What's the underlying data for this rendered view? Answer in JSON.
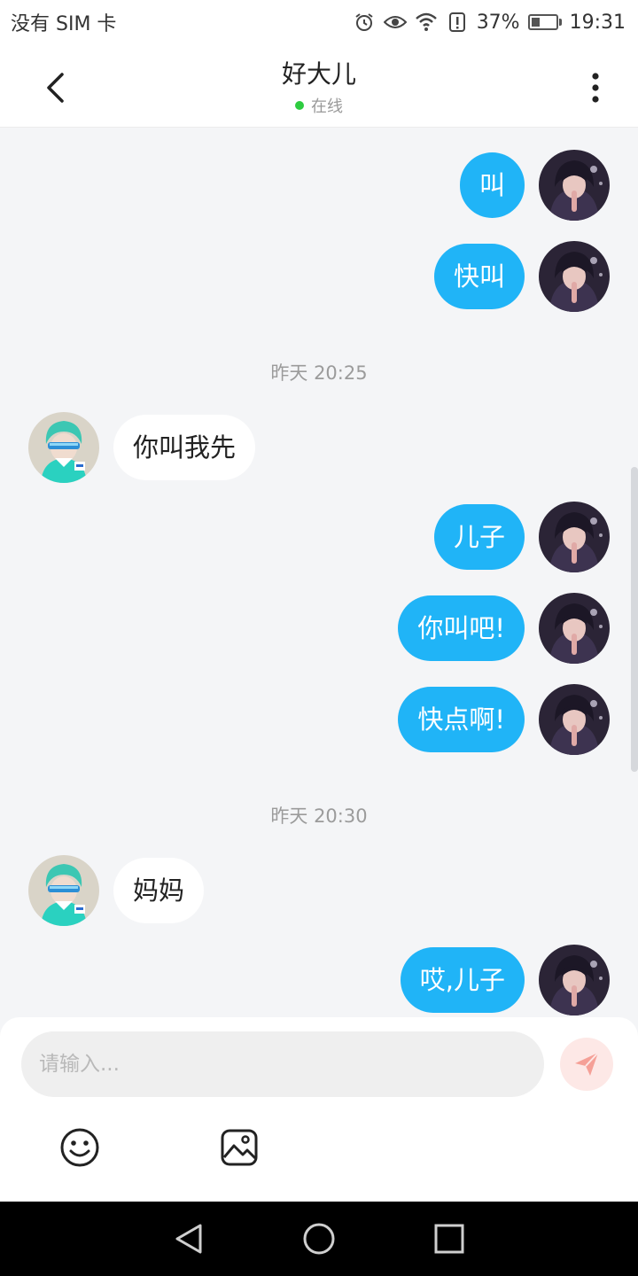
{
  "status_bar": {
    "carrier": "没有 SIM 卡",
    "battery": "37%",
    "battery_level": 0.37,
    "time": "19:31",
    "icons": [
      "alarm-icon",
      "eye-icon",
      "wifi-icon",
      "alert-icon",
      "battery-icon"
    ]
  },
  "header": {
    "title": "好大儿",
    "status": "在线",
    "back_icon": "back-arrow-icon",
    "more_icon": "more-vertical-icon"
  },
  "messages": [
    {
      "from": "me",
      "text": "叫"
    },
    {
      "from": "me",
      "text": "快叫"
    },
    {
      "type": "time",
      "text": "昨天 20:25"
    },
    {
      "from": "them",
      "text": "你叫我先"
    },
    {
      "from": "me",
      "text": "儿子"
    },
    {
      "from": "me",
      "text": "你叫吧!"
    },
    {
      "from": "me",
      "text": "快点啊!"
    },
    {
      "type": "time",
      "text": "昨天 20:30"
    },
    {
      "from": "them",
      "text": "妈妈"
    },
    {
      "from": "me",
      "text": "哎,儿子"
    }
  ],
  "input": {
    "placeholder": "请输入...",
    "value": "",
    "send_icon": "send-paper-plane-icon"
  },
  "toolbar": {
    "emoji_icon": "emoji-icon",
    "image_icon": "image-icon"
  },
  "colors": {
    "accent": "#20b4f7",
    "online": "#2ecc40",
    "send_button_bg": "#fde8e6",
    "send_icon": "#f5a097"
  }
}
